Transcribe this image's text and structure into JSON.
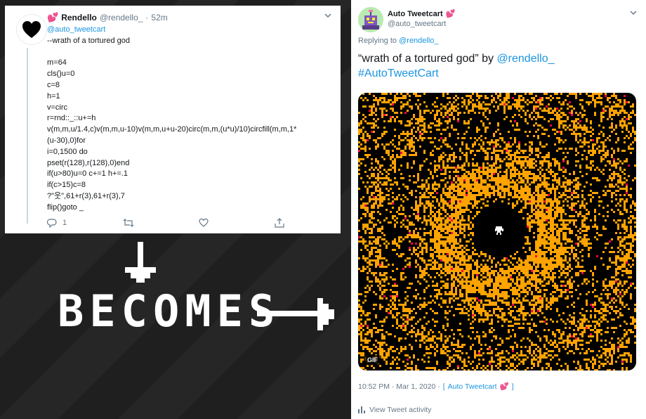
{
  "left_tweet": {
    "heart_emoji": "💕",
    "author_name": "Rendello",
    "author_handle": "@rendello_",
    "separator": "·",
    "time": "52m",
    "mention": "@auto_tweetcart",
    "code_lines": [
      "--wrath of a tortured god",
      "",
      "m=64",
      "cls()u=0",
      "c=8",
      "h=1",
      "v=circ",
      "r=rnd::_::u+=h",
      "v(m,m,u/1.4,c)v(m,m,u-10)v(m,m,u+u-20)circ(m,m,(u*u)/10)circfill(m,m,1*",
      "(u-30),0)for",
      "i=0,1500 do",
      "pset(r(128),r(128),0)end",
      "if(u>80)u=0 c+=1 h+=.1",
      "if(c>15)c=8",
      "?\"웃\",61+r(3),61+r(3),7",
      "flip()goto _"
    ],
    "reply_count": "1"
  },
  "banner": {
    "becomes_text": "BECOMES"
  },
  "right_tweet": {
    "author_name": "Auto Tweetcart",
    "heart_emoji": "💕",
    "author_handle": "@auto_tweetcart",
    "replying_prefix": "Replying to",
    "replying_to": "@rendello_",
    "text_quote": "“wrath of a tortured god” by",
    "text_mention": "@rendello_",
    "text_hashtag": "#AutoTweetCart",
    "gif_badge": "GIF",
    "timestamp": "10:52 PM · Mar 1, 2020 ·",
    "source_open": "[",
    "source_name": "Auto Tweetcart",
    "source_close": "]",
    "activity_label": "View Tweet activity"
  },
  "colors": {
    "link": "#1b95e0",
    "heart": "#e0245e",
    "muted": "#657786",
    "media_orange": "#ffa300",
    "media_red": "#ff004d"
  },
  "icons": [
    "black-heart-icon",
    "chevron-down-icon",
    "reply-icon",
    "retweet-icon",
    "like-icon",
    "share-icon",
    "arrow-down-icon",
    "arrow-right-icon",
    "bar-chart-icon",
    "robot-avatar-icon"
  ]
}
